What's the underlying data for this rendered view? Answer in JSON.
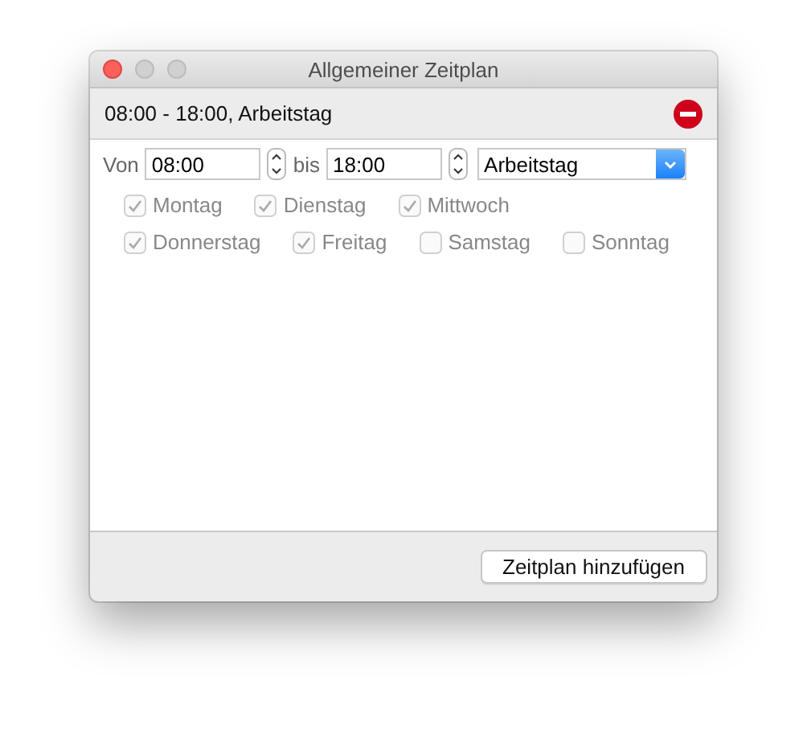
{
  "window": {
    "title": "Allgemeiner Zeitplan"
  },
  "schedule_header": {
    "title": "08:00 - 18:00, Arbeitstag"
  },
  "form": {
    "from_label": "Von",
    "from_value": "08:00",
    "to_label": "bis",
    "to_value": "18:00",
    "day_type": "Arbeitstag"
  },
  "day_rows": [
    [
      {
        "label": "Montag",
        "checked": true,
        "disabled": true
      },
      {
        "label": "Dienstag",
        "checked": true,
        "disabled": true
      },
      {
        "label": "Mittwoch",
        "checked": true,
        "disabled": true
      }
    ],
    [
      {
        "label": "Donnerstag",
        "checked": true,
        "disabled": true
      },
      {
        "label": "Freitag",
        "checked": true,
        "disabled": true
      },
      {
        "label": "Samstag",
        "checked": false,
        "disabled": true
      },
      {
        "label": "Sonntag",
        "checked": false,
        "disabled": true
      }
    ]
  ],
  "buttons": [
    "Zeitplan hinzufügen"
  ]
}
